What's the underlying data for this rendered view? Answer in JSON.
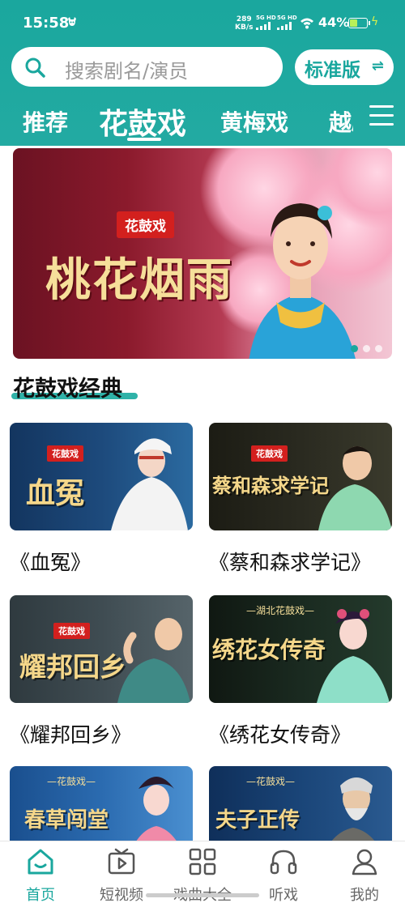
{
  "status_bar": {
    "time": "15:58",
    "net_speed_value": "289",
    "net_speed_unit": "KB/s",
    "sig1": "5G HD",
    "sig2": "5G HD",
    "battery": "44%",
    "battery_level": 0.44
  },
  "search": {
    "placeholder": "搜索剧名/演员"
  },
  "edition": {
    "label": "标准版",
    "switch_glyph": "⇌"
  },
  "tabs": [
    {
      "label": "推荐"
    },
    {
      "label": "花鼓戏"
    },
    {
      "label": "黄梅戏"
    },
    {
      "label": "越剧"
    }
  ],
  "active_tab": 1,
  "banner": {
    "tag": "花鼓戏",
    "title": "桃花烟雨",
    "dots": 3,
    "active_dot": 0
  },
  "section": {
    "title": "花鼓戏经典"
  },
  "cards": [
    {
      "tag": "花鼓戏",
      "thumb_title": "血冤",
      "name": "《血冤》"
    },
    {
      "tag": "花鼓戏",
      "thumb_title": "蔡和森求学记",
      "name": "《蔡和森求学记》"
    },
    {
      "tag": "花鼓戏",
      "thumb_title": "耀邦回乡",
      "name": "《耀邦回乡》"
    },
    {
      "tagline": "—湖北花鼓戏—",
      "thumb_title": "绣花女传奇",
      "name": "《绣花女传奇》"
    },
    {
      "tagline": "—花鼓戏—",
      "thumb_title": "春草闯堂",
      "name": ""
    },
    {
      "tagline": "—花鼓戏—",
      "thumb_title": "夫子正传",
      "name": ""
    }
  ],
  "bottom_nav": [
    {
      "label": "首页",
      "icon": "home-icon"
    },
    {
      "label": "短视频",
      "icon": "tv-play-icon"
    },
    {
      "label": "戏曲大全",
      "icon": "grid-icon"
    },
    {
      "label": "听戏",
      "icon": "headphones-icon"
    },
    {
      "label": "我的",
      "icon": "person-icon"
    }
  ],
  "colors": {
    "accent": "#1aa79e",
    "tag_red": "#d3201e"
  }
}
